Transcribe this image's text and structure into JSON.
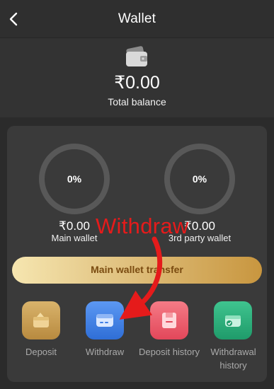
{
  "header": {
    "title": "Wallet"
  },
  "summary": {
    "balance": "₹0.00",
    "balance_label": "Total balance"
  },
  "wallets": [
    {
      "percent": "0%",
      "amount": "₹0.00",
      "label": "Main wallet"
    },
    {
      "percent": "0%",
      "amount": "₹0.00",
      "label": "3rd party wallet"
    }
  ],
  "transfer_button": {
    "label": "Main wallet transfer"
  },
  "actions": [
    {
      "label": "Deposit",
      "icon": "deposit-icon"
    },
    {
      "label": "Withdraw",
      "icon": "withdraw-icon"
    },
    {
      "label": "Deposit history",
      "icon": "deposit-history-icon"
    },
    {
      "label": "Withdrawal history",
      "icon": "withdrawal-history-icon"
    }
  ],
  "annotation": {
    "text": "Withdraw",
    "color": "#e51b1b"
  },
  "colors": {
    "deposit": "#c9a25a",
    "withdraw": "#3f7fe6",
    "deposit_history": "#ee5a6a",
    "withdrawal_history": "#27a778",
    "gold_accent": "#d9b46a"
  }
}
